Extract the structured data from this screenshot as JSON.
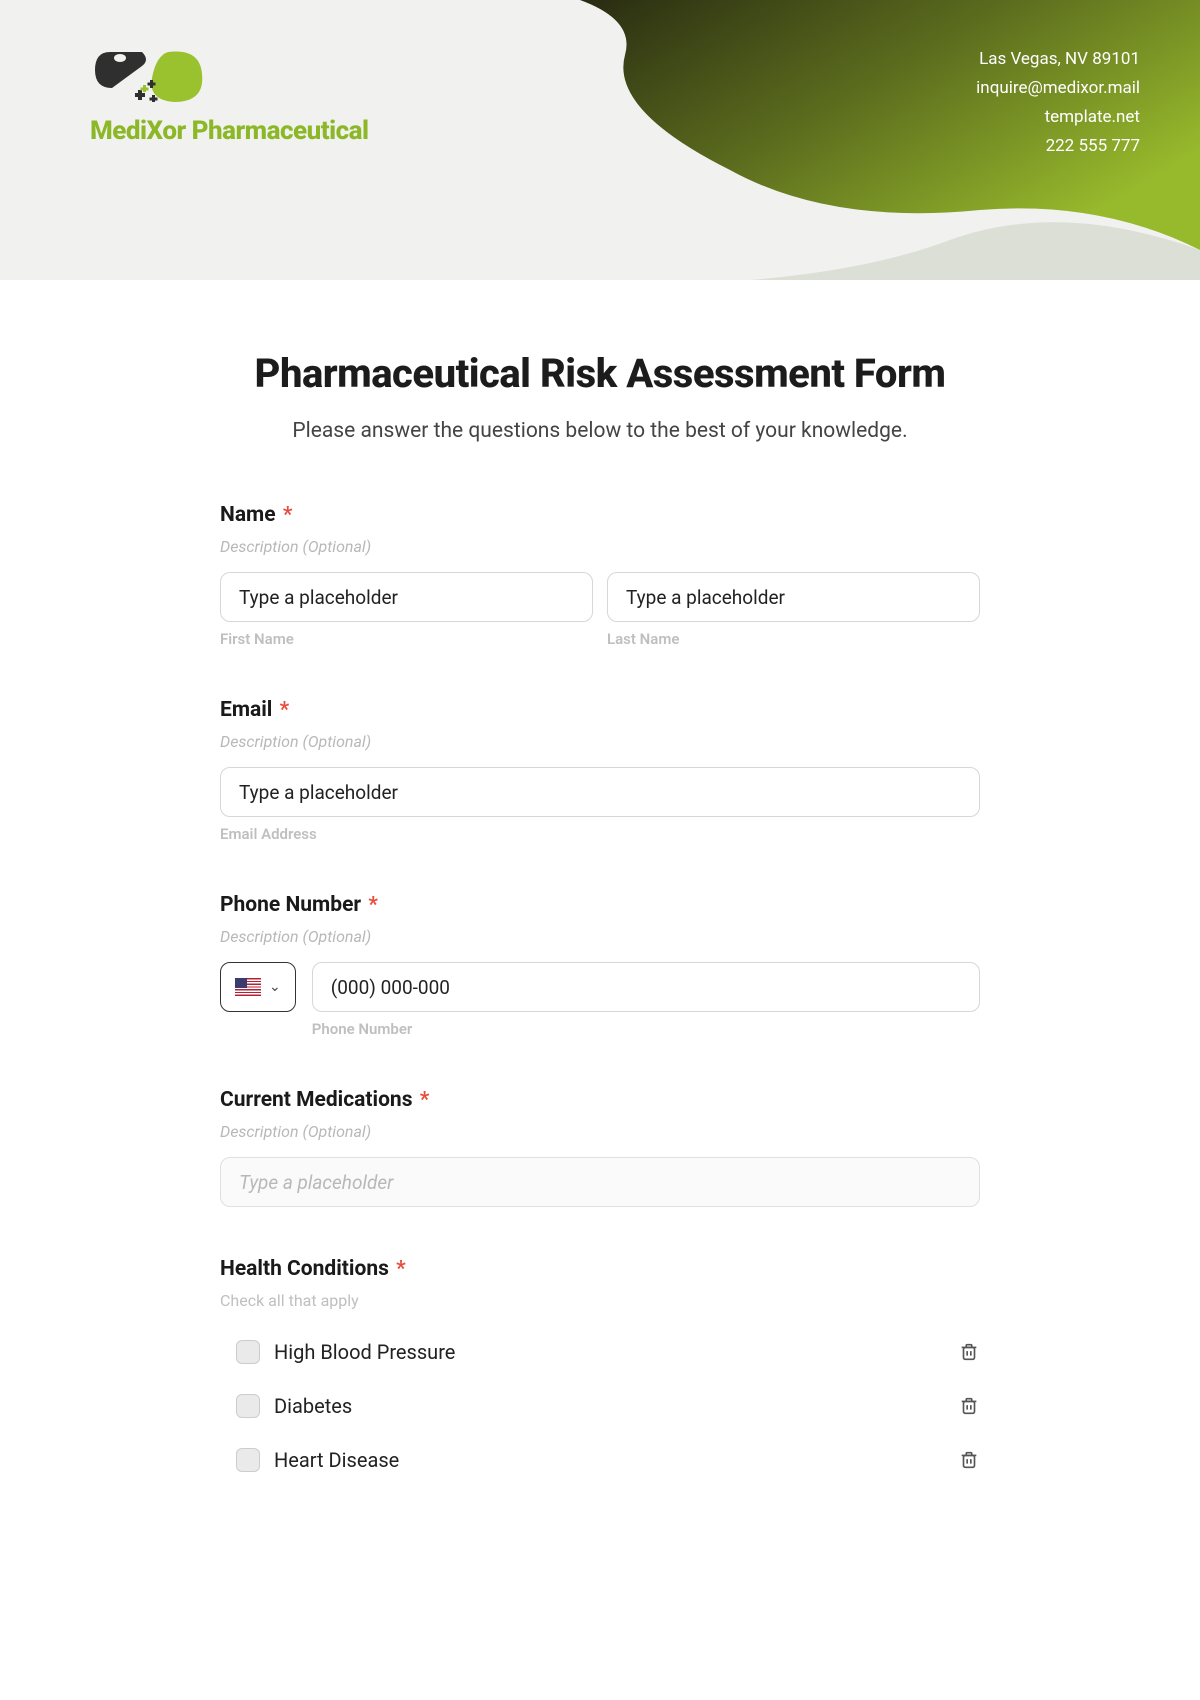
{
  "header": {
    "company_name": "MediXor Pharmaceutical",
    "address": "Las Vegas, NV 89101",
    "email": "inquire@medixor.mail",
    "website": "template.net",
    "phone": "222 555 777"
  },
  "form": {
    "title": "Pharmaceutical Risk Assessment Form",
    "subtitle": "Please answer the questions below to the best of your knowledge."
  },
  "name": {
    "label": "Name",
    "desc": "Description (Optional)",
    "first_ph": "Type a placeholder",
    "first_sub": "First Name",
    "last_ph": "Type a placeholder",
    "last_sub": "Last Name"
  },
  "email": {
    "label": "Email",
    "desc": "Description (Optional)",
    "ph": "Type a placeholder",
    "sub": "Email Address"
  },
  "phone": {
    "label": "Phone Number",
    "desc": "Description (Optional)",
    "ph": "(000) 000-000",
    "sub": "Phone Number"
  },
  "meds": {
    "label": "Current Medications",
    "desc": "Description (Optional)",
    "ph": "Type a placeholder"
  },
  "conditions": {
    "label": "Health Conditions",
    "instruction": "Check all that apply",
    "items": {
      "0": "High Blood Pressure",
      "1": "Diabetes",
      "2": "Heart Disease"
    }
  },
  "required_mark": "*"
}
